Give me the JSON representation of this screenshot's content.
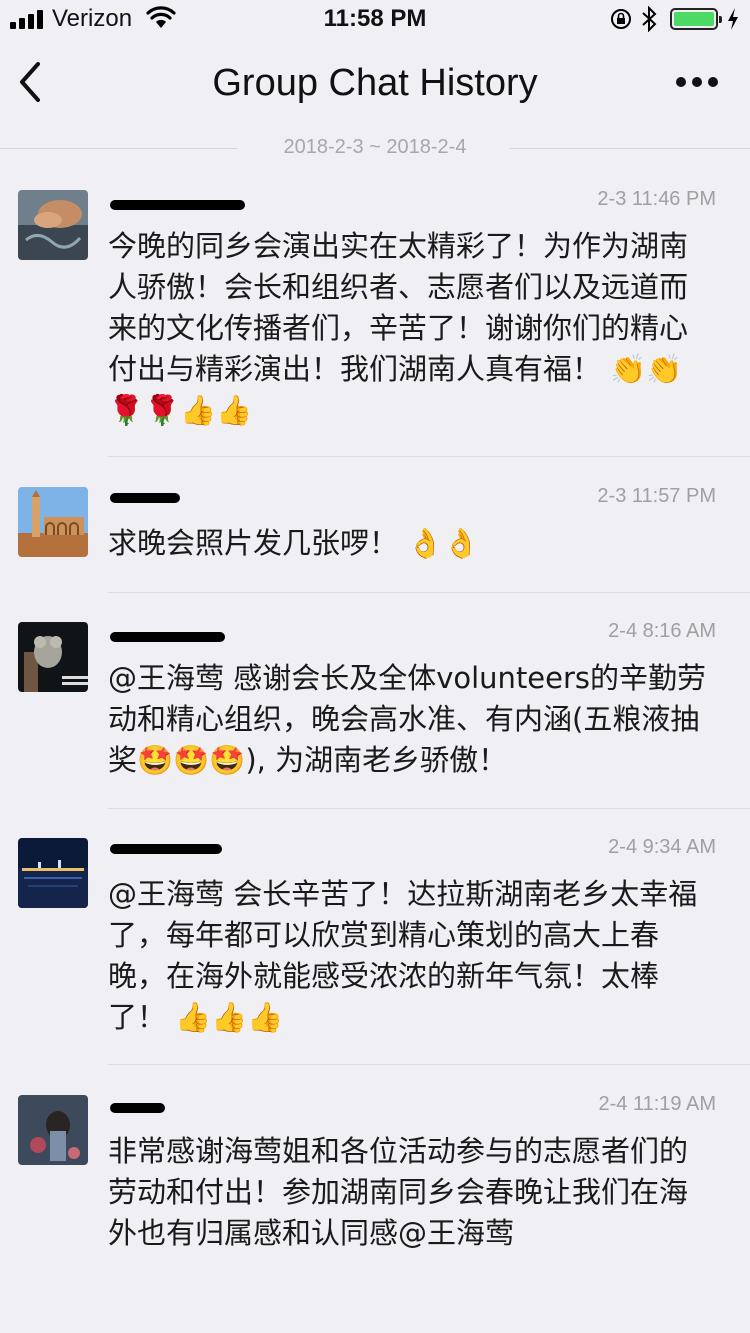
{
  "status_bar": {
    "carrier": "Verizon",
    "time": "11:58 PM"
  },
  "nav": {
    "title": "Group Chat History"
  },
  "date_range": "2018-2-3 ~ 2018-2-4",
  "messages": [
    {
      "time": "2-3 11:46 PM",
      "text": "今晚的同乡会演出实在太精彩了！为作为湖南人骄傲！会长和组织者、志愿者们以及远道而来的文化传播者们，辛苦了！谢谢你们的精心付出与精彩演出！我们湖南人真有福！ 👏👏🌹🌹👍👍"
    },
    {
      "time": "2-3 11:57 PM",
      "text": "求晚会照片发几张啰！ 👌👌"
    },
    {
      "time": "2-4 8:16 AM",
      "text": "@王海莺 感谢会长及全体volunteers的辛勤劳动和精心组织，晚会高水准、有内涵(五粮液抽奖🤩🤩🤩), 为湖南老乡骄傲！"
    },
    {
      "time": "2-4 9:34 AM",
      "text": "@王海莺 会长辛苦了！达拉斯湖南老乡太幸福了，每年都可以欣赏到精心策划的高大上春晚，在海外就能感受浓浓的新年气氛！太棒了！ 👍👍👍"
    },
    {
      "time": "2-4 11:19 AM",
      "text": "非常感谢海莺姐和各位活动参与的志愿者们的劳动和付出！参加湖南同乡会春晚让我们在海外也有归属感和认同感@王海莺"
    }
  ],
  "colors": {
    "background": "#efeff4",
    "battery_fill": "#4cd964",
    "muted_text": "#a0a0a0"
  }
}
